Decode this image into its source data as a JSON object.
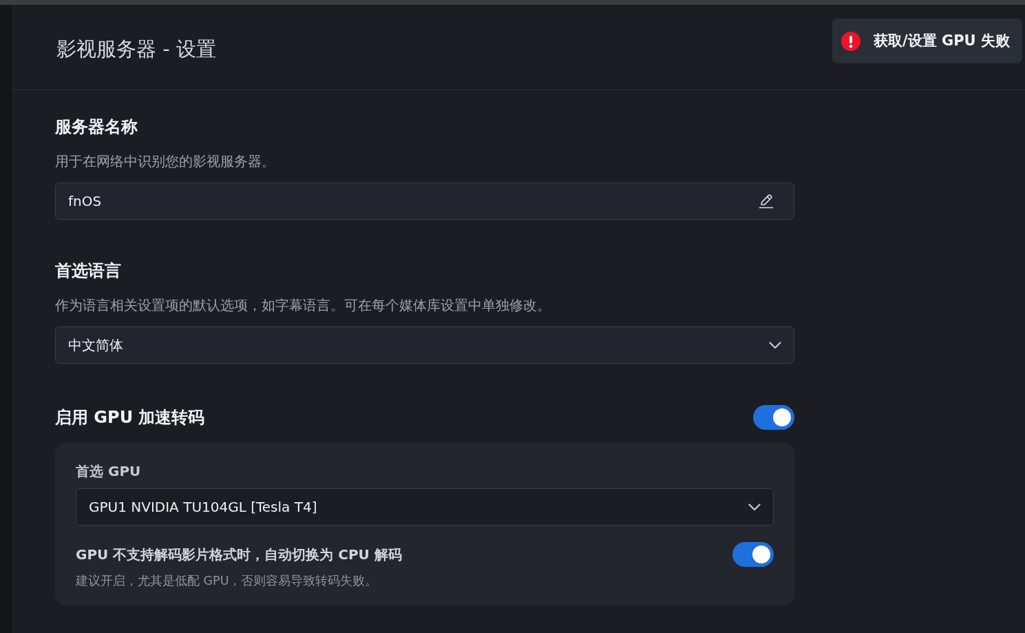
{
  "page": {
    "title": "影视服务器 - 设置"
  },
  "toast": {
    "kind": "error",
    "message": "获取/设置 GPU 失败"
  },
  "sections": [
    {
      "kind": "text_input",
      "title": "服务器名称",
      "description": "用于在网络中识别您的影视服务器。",
      "field": {
        "value": "fnOS"
      }
    },
    {
      "kind": "select",
      "title": "首选语言",
      "description": "作为语言相关设置项的默认选项，如字幕语言。可在每个媒体库设置中单独修改。",
      "field": {
        "value": "中文简体"
      }
    },
    {
      "kind": "toggle_group",
      "title": "启用 GPU 加速转码",
      "on": true,
      "panel": {
        "label": "首选 GPU",
        "select": {
          "value": "GPU1 NVIDIA TU104GL [Tesla T4]"
        },
        "option": {
          "title": "GPU 不支持解码影片格式时，自动切换为 CPU 解码",
          "description": "建议开启，尤其是低配 GPU，否则容易导致转码失败。",
          "on": true
        }
      }
    }
  ]
}
